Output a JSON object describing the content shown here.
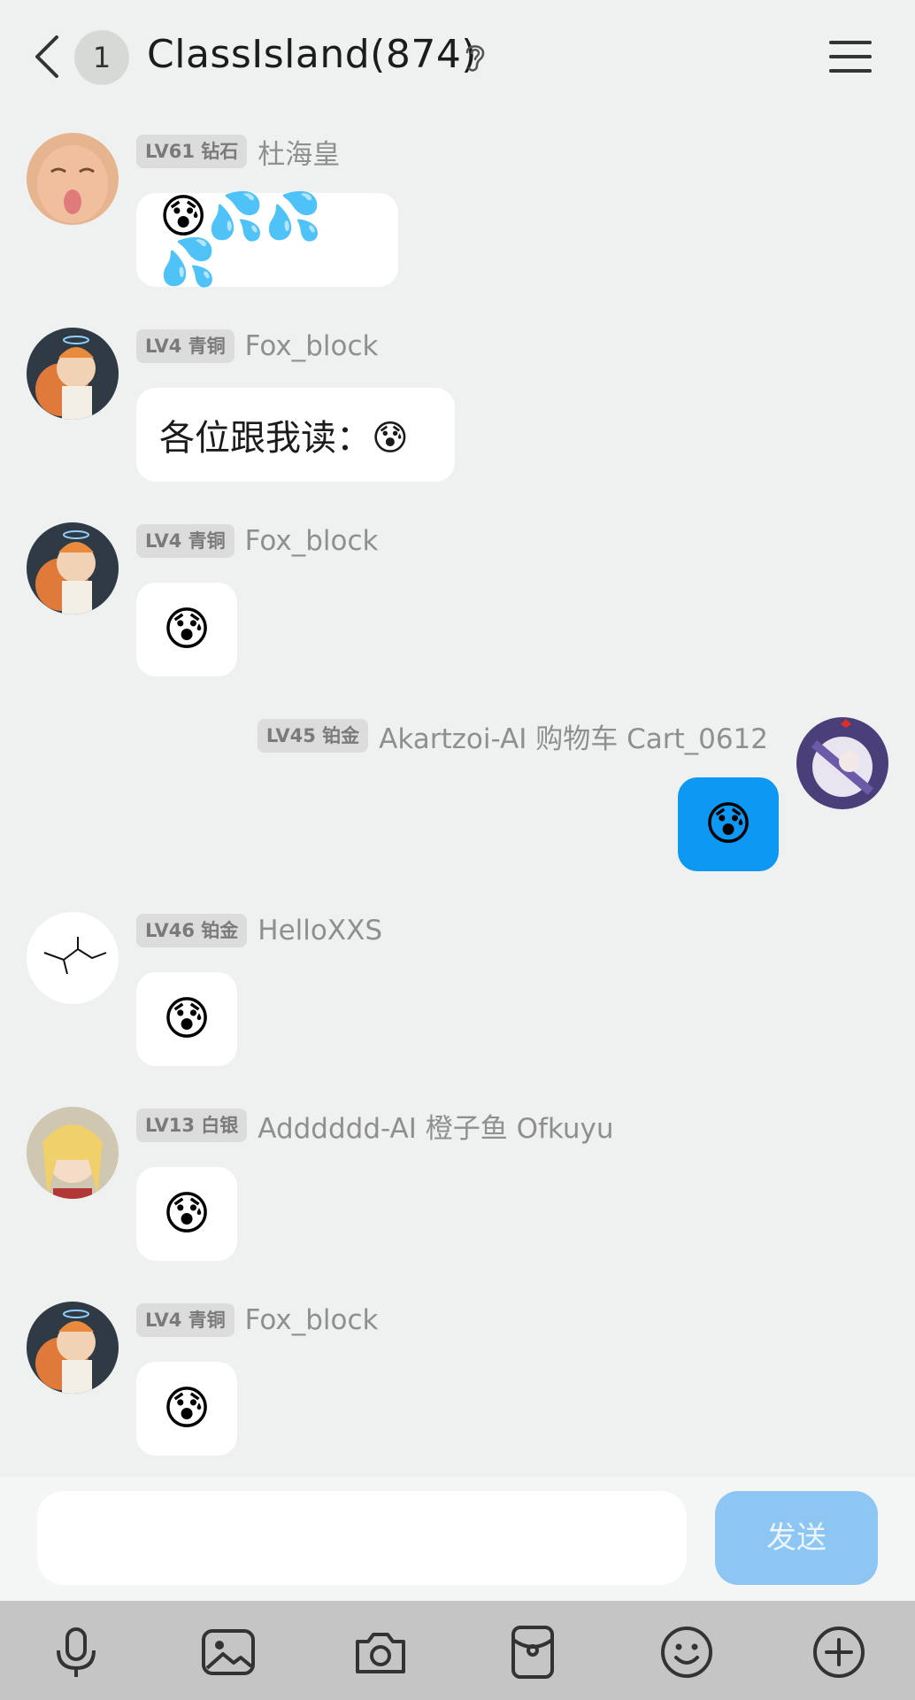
{
  "header": {
    "unread_count": "1",
    "title": "ClassIsland(874)"
  },
  "messages": [
    {
      "level": "LV61 钻石",
      "name": "杜海皇",
      "text": "😰💦💦💦"
    },
    {
      "level": "LV4 青铜",
      "name": "Fox_block",
      "text": "各位跟我读：😰"
    },
    {
      "level": "LV4 青铜",
      "name": "Fox_block",
      "text": "😰"
    },
    {
      "level": "LV45 铂金",
      "name": "Akartzoi-AI 购物车 Cart_0612",
      "text": "😰"
    },
    {
      "level": "LV46 铂金",
      "name": "HelloXXS",
      "text": "😰"
    },
    {
      "level": "LV13 白银",
      "name": "Adddddd-AI 橙子鱼 Ofkuyu",
      "text": "😰"
    },
    {
      "level": "LV4 青铜",
      "name": "Fox_block",
      "text": "😰"
    }
  ],
  "composer": {
    "input_value": "",
    "send_label": "发送"
  },
  "toolbar": {
    "icons": [
      "microphone-icon",
      "image-icon",
      "camera-icon",
      "red-packet-icon",
      "emoji-icon",
      "plus-icon"
    ]
  },
  "colors": {
    "background": "#eef1ef",
    "self_bubble": "#0c98f3",
    "send_button": "#8dc6f3",
    "toolbar": "#c5c5c5"
  }
}
